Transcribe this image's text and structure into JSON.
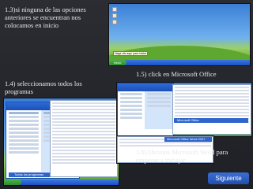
{
  "captions": {
    "step3": "1.3)si ninguna de las opciones anteriores se encuentran   nos colocamos en  inicio",
    "step4": "1.4) seleccionamos todos los programas",
    "step5": "1.5)  click en Microsoft Office",
    "step6": "1.6)Abrimos Microsoft Word para empezar a trabajar"
  },
  "screens": {
    "start_tooltip": "Haga clic aquí para iniciar",
    "start_button": "Inicio",
    "all_programs": "Todos los programas",
    "office_item": "Microsoft Office",
    "word_item": "Microsoft Office Word 2007"
  },
  "nav": {
    "next_label": "Siguiente"
  },
  "colors": {
    "background": "#23252b",
    "button": "#2f5fc4",
    "xp_blue": "#245edb",
    "xp_green": "#3c9e3c"
  }
}
